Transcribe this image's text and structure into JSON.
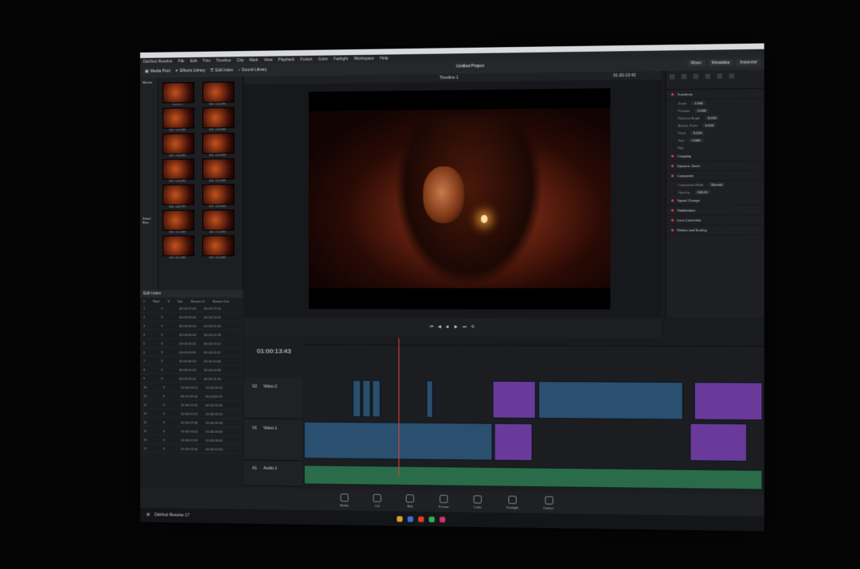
{
  "window": {
    "title": "DaVinci Resolve 17"
  },
  "toolbar": {
    "media_pool": "Media Pool",
    "effects_library": "Effects Library",
    "edit_index": "Edit Index",
    "sound_library": "Sound Library",
    "project_name": "Untitled Project",
    "right_tabs": [
      "Mixer",
      "Metadata",
      "Inspector"
    ]
  },
  "viewer": {
    "timeline_name": "Timeline 1",
    "timecode_top": "01:00:13:43"
  },
  "timeline": {
    "timecode": "01:00:13:43",
    "tracks": [
      {
        "name": "Video 2",
        "label": "V2"
      },
      {
        "name": "Video 1",
        "label": "V1"
      },
      {
        "name": "Audio 1",
        "label": "A1"
      }
    ]
  },
  "inspector": {
    "sections": [
      "Transform",
      "Cropping",
      "Dynamic Zoom",
      "Composite",
      "Speed Change",
      "Stabilization",
      "Lens Correction",
      "Retime and Scaling"
    ],
    "transform_rows": [
      {
        "label": "Zoom",
        "value": "1.000"
      },
      {
        "label": "Position",
        "value": "0.000"
      },
      {
        "label": "Rotation Angle",
        "value": "0.000"
      },
      {
        "label": "Anchor Point",
        "value": "0.000"
      },
      {
        "label": "Pitch",
        "value": "0.000"
      },
      {
        "label": "Yaw",
        "value": "0.000"
      },
      {
        "label": "Flip",
        "value": ""
      }
    ],
    "composite_mode": "Normal",
    "opacity": "100.00"
  },
  "media_pool": {
    "sidebar": [
      "Master",
      "Smart Bins"
    ],
    "clips": [
      "Timeline 1",
      "IMG_0101.MP4",
      "IMG_0102.MP4",
      "IMG_0103.MP4",
      "IMG_0104.MP4",
      "IMG_0105.MP4",
      "IMG_0106.MP4",
      "IMG_0107.MP4",
      "IMG_0108.MP4",
      "IMG_0109.MP4",
      "IMG_0110.MP4",
      "IMG_0111.MP4",
      "IMG_0112.MP4",
      "IMG_0113.MP4"
    ]
  },
  "metadata": {
    "title": "Edit Index",
    "columns": [
      "#",
      "Reel",
      "V",
      "Dur",
      "Source In",
      "Source Out"
    ],
    "rows": [
      [
        "1",
        "",
        "V",
        "",
        "00:00:22:00",
        "00:00:29:10"
      ],
      [
        "2",
        "",
        "V",
        "",
        "00:00:09:00",
        "00:00:13:22"
      ],
      [
        "3",
        "",
        "V",
        "",
        "00:00:04:10",
        "00:00:07:05"
      ],
      [
        "4",
        "",
        "V",
        "",
        "00:00:00:00",
        "00:00:02:18"
      ],
      [
        "5",
        "",
        "V",
        "",
        "00:00:12:20",
        "00:00:15:12"
      ],
      [
        "6",
        "",
        "V",
        "",
        "00:00:03:00",
        "00:00:05:11"
      ],
      [
        "7",
        "",
        "V",
        "",
        "00:00:08:16",
        "00:00:10:00"
      ],
      [
        "8",
        "",
        "V",
        "",
        "00:00:01:02",
        "00:00:04:09"
      ],
      [
        "9",
        "",
        "V",
        "",
        "00:00:19:00",
        "00:00:21:20"
      ],
      [
        "10",
        "",
        "V",
        "",
        "00:00:06:12",
        "00:00:09:01"
      ],
      [
        "11",
        "",
        "V",
        "",
        "00:00:02:00",
        "00:00:03:19"
      ],
      [
        "12",
        "",
        "V",
        "",
        "00:00:11:05",
        "00:00:13:00"
      ],
      [
        "13",
        "",
        "V",
        "",
        "00:00:00:15",
        "00:00:02:22"
      ],
      [
        "14",
        "",
        "V",
        "",
        "00:00:07:00",
        "00:00:09:08"
      ],
      [
        "15",
        "",
        "V",
        "",
        "00:00:16:10",
        "00:00:18:03"
      ],
      [
        "16",
        "",
        "V",
        "",
        "00:00:05:20",
        "00:00:08:00"
      ],
      [
        "17",
        "",
        "V",
        "",
        "00:00:13:00",
        "00:00:14:20"
      ]
    ]
  },
  "pages": [
    "Media",
    "Cut",
    "Edit",
    "Fusion",
    "Color",
    "Fairlight",
    "Deliver"
  ],
  "taskbar": {
    "app": "DaVinci Resolve 17"
  }
}
